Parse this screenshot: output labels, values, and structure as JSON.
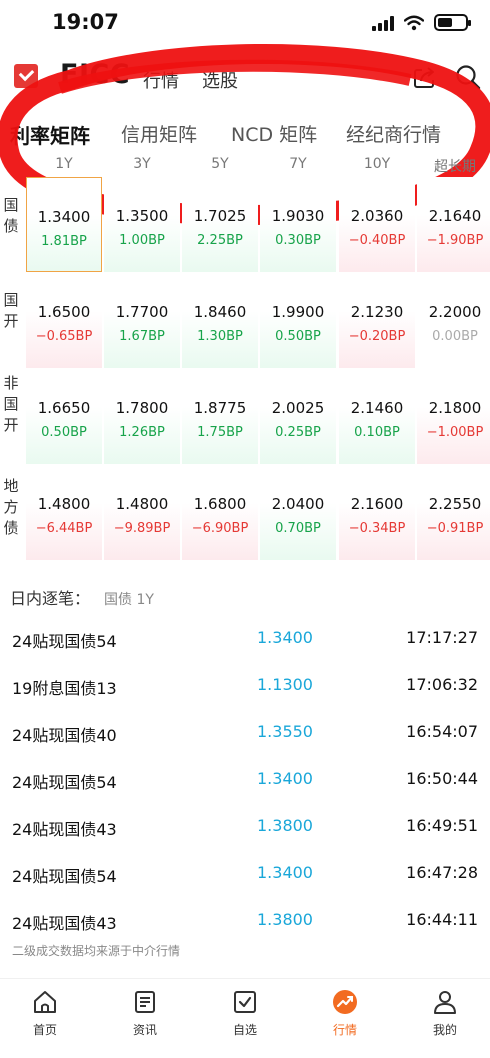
{
  "status": {
    "time": "19:07"
  },
  "header": {
    "app_name": "FICC",
    "nav": [
      "行情",
      "选股"
    ]
  },
  "tabs": [
    {
      "label": "利率矩阵",
      "active": true
    },
    {
      "label": "信用矩阵",
      "active": false
    },
    {
      "label": "NCD 矩阵",
      "active": false
    },
    {
      "label": "经纪商行情",
      "active": false
    }
  ],
  "matrix": {
    "columns": [
      "1Y",
      "3Y",
      "5Y",
      "7Y",
      "10Y",
      "超长期"
    ],
    "rows": [
      {
        "label": [
          "国",
          "债"
        ],
        "cells": [
          {
            "rate": "1.3400",
            "bp": "1.81BP",
            "dir": "up"
          },
          {
            "rate": "1.3500",
            "bp": "1.00BP",
            "dir": "up"
          },
          {
            "rate": "1.7025",
            "bp": "2.25BP",
            "dir": "up"
          },
          {
            "rate": "1.9030",
            "bp": "0.30BP",
            "dir": "up"
          },
          {
            "rate": "2.0360",
            "bp": "−0.40BP",
            "dir": "down"
          },
          {
            "rate": "2.1640",
            "bp": "−1.90BP",
            "dir": "down"
          }
        ]
      },
      {
        "label": [
          "国",
          "开"
        ],
        "cells": [
          {
            "rate": "1.6500",
            "bp": "−0.65BP",
            "dir": "down"
          },
          {
            "rate": "1.7700",
            "bp": "1.67BP",
            "dir": "up"
          },
          {
            "rate": "1.8460",
            "bp": "1.30BP",
            "dir": "up"
          },
          {
            "rate": "1.9900",
            "bp": "0.50BP",
            "dir": "up"
          },
          {
            "rate": "2.1230",
            "bp": "−0.20BP",
            "dir": "down"
          },
          {
            "rate": "2.2000",
            "bp": "0.00BP",
            "dir": "flat"
          }
        ]
      },
      {
        "label": [
          "非",
          "国",
          "开"
        ],
        "cells": [
          {
            "rate": "1.6650",
            "bp": "0.50BP",
            "dir": "up"
          },
          {
            "rate": "1.7800",
            "bp": "1.26BP",
            "dir": "up"
          },
          {
            "rate": "1.8775",
            "bp": "1.75BP",
            "dir": "up"
          },
          {
            "rate": "2.0025",
            "bp": "0.25BP",
            "dir": "up"
          },
          {
            "rate": "2.1460",
            "bp": "0.10BP",
            "dir": "up"
          },
          {
            "rate": "2.1800",
            "bp": "−1.00BP",
            "dir": "down"
          }
        ]
      },
      {
        "label": [
          "地",
          "方",
          "债"
        ],
        "cells": [
          {
            "rate": "1.4800",
            "bp": "−6.44BP",
            "dir": "down"
          },
          {
            "rate": "1.4800",
            "bp": "−9.89BP",
            "dir": "down"
          },
          {
            "rate": "1.6800",
            "bp": "−6.90BP",
            "dir": "down"
          },
          {
            "rate": "2.0400",
            "bp": "0.70BP",
            "dir": "up"
          },
          {
            "rate": "2.1600",
            "bp": "−0.34BP",
            "dir": "down"
          },
          {
            "rate": "2.2550",
            "bp": "−0.91BP",
            "dir": "down"
          }
        ]
      }
    ]
  },
  "trades": {
    "title": "日内逐笔：",
    "subtitle": "国债 1Y",
    "rows": [
      {
        "name": "24贴现国债54",
        "price": "1.3400",
        "time": "17:17:27"
      },
      {
        "name": "19附息国债13",
        "price": "1.1300",
        "time": "17:06:32"
      },
      {
        "name": "24贴现国债40",
        "price": "1.3550",
        "time": "16:54:07"
      },
      {
        "name": "24贴现国债54",
        "price": "1.3400",
        "time": "16:50:44"
      },
      {
        "name": "24贴现国债43",
        "price": "1.3800",
        "time": "16:49:51"
      },
      {
        "name": "24贴现国债54",
        "price": "1.3400",
        "time": "16:47:28"
      },
      {
        "name": "24贴现国债43",
        "price": "1.3800",
        "time": "16:44:11"
      }
    ],
    "note": "二级成交数据均来源于中介行情"
  },
  "bottom_nav": [
    {
      "label": "首页",
      "icon": "home-icon",
      "active": false
    },
    {
      "label": "资讯",
      "icon": "news-icon",
      "active": false
    },
    {
      "label": "自选",
      "icon": "watchlist-icon",
      "active": false
    },
    {
      "label": "行情",
      "icon": "market-icon",
      "active": true
    },
    {
      "label": "我的",
      "icon": "profile-icon",
      "active": false
    }
  ],
  "colors": {
    "up": "#17a34a",
    "down": "#e53935",
    "price": "#1aa7d9",
    "accent": "#f26b21",
    "annotation": "#ee1111"
  }
}
